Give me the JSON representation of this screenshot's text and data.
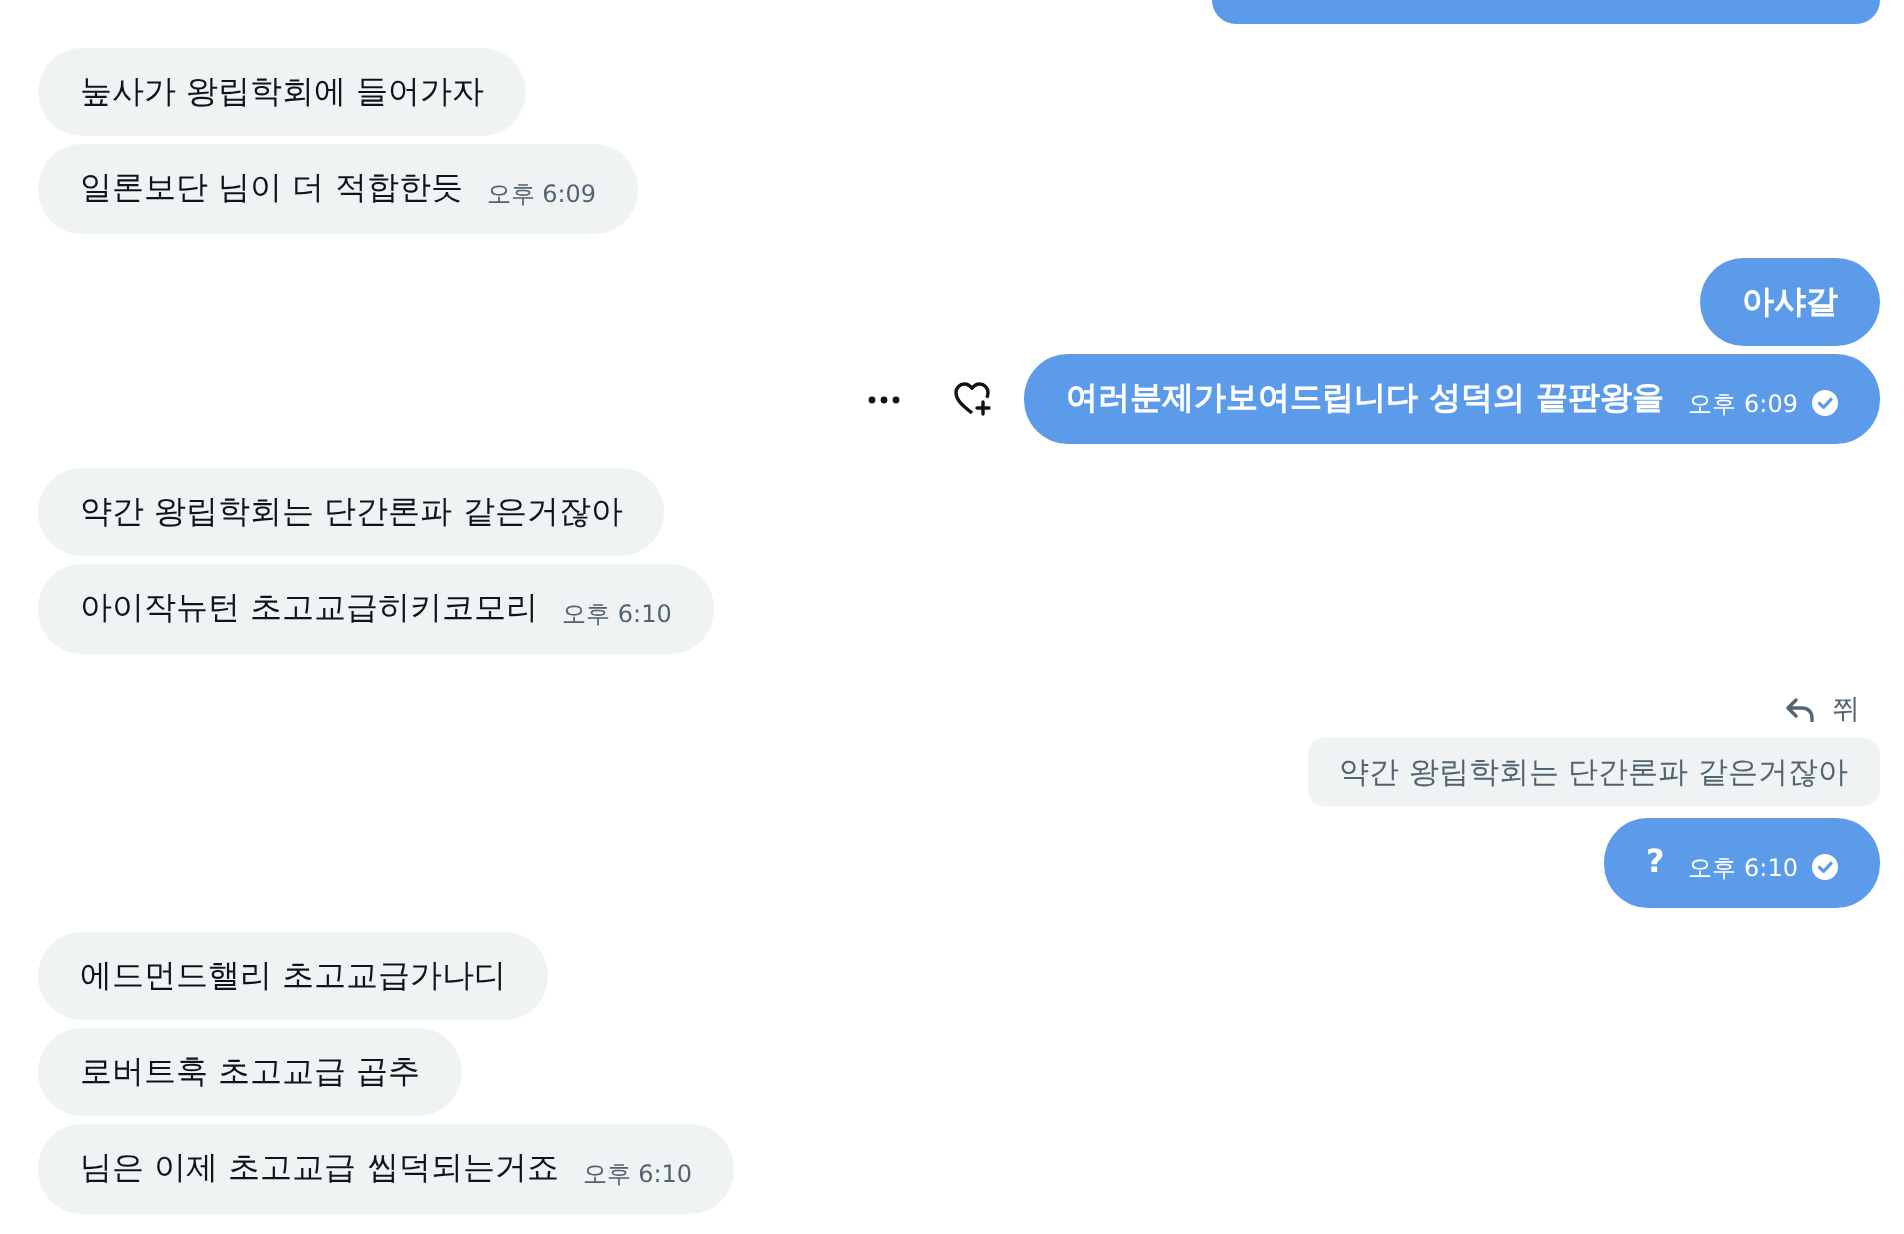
{
  "messages": [
    {
      "outgoing": true,
      "kind": "clipped",
      "hovered": false
    },
    {
      "outgoing": false,
      "kind": "text",
      "text": "눞사가 왕립학회에 들어가자",
      "hovered": false
    },
    {
      "outgoing": false,
      "kind": "text",
      "text": "일론보단 님이 더 적합한듯",
      "time": "오후 6:09",
      "hovered": false
    },
    {
      "outgoing": true,
      "kind": "text",
      "text": "아샤갈",
      "hovered": false
    },
    {
      "outgoing": true,
      "kind": "text",
      "text": "여러분제가보여드립니다 성덕의 끝판왕을",
      "time": "오후 6:09",
      "read": true,
      "hovered": true
    },
    {
      "outgoing": false,
      "kind": "text",
      "text": "약간 왕립학회는 단간론파 같은거잖아",
      "hovered": false
    },
    {
      "outgoing": false,
      "kind": "text",
      "text": "아이작뉴턴 초고교급히키코모리",
      "time": "오후 6:10",
      "hovered": false
    },
    {
      "outgoing": true,
      "kind": "reply",
      "reply_to": {
        "label": "쮜",
        "quote": "약간 왕립학회는 단간론파 같은거잖아"
      },
      "text": "?",
      "time": "오후 6:10",
      "read": true,
      "hovered": false
    },
    {
      "outgoing": false,
      "kind": "text",
      "text": "에드먼드핼리 초고교급가나디",
      "hovered": false
    },
    {
      "outgoing": false,
      "kind": "text",
      "text": "로버트훅 초고교급 곱추",
      "hovered": false
    },
    {
      "outgoing": false,
      "kind": "text",
      "text": "님은 이제 초고교급 씹덕되는거죠",
      "time": "오후 6:10",
      "hovered": false
    }
  ]
}
